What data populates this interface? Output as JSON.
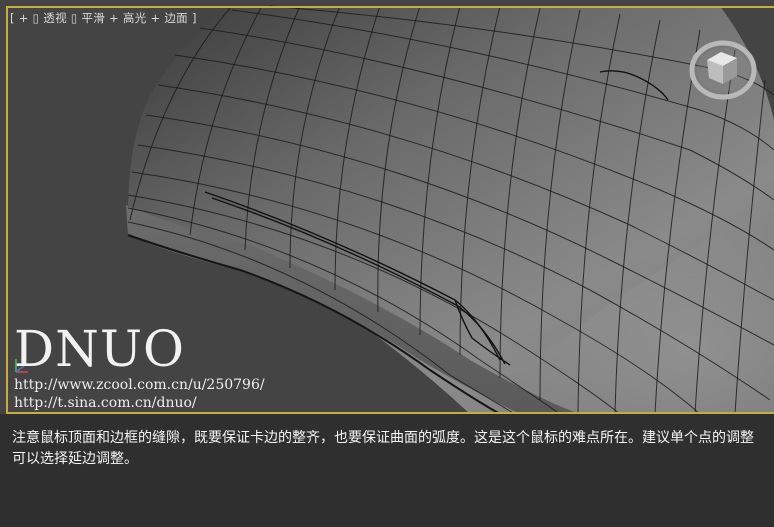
{
  "viewport": {
    "label": {
      "bracket_open": "[",
      "plus": "+",
      "view": "透视",
      "shading": "平滑 + 高光 + 边面",
      "bracket_close": "]",
      "glyph": "▯"
    },
    "border_color": "#c9ac3d",
    "background": "#444444",
    "icons": [
      "viewcube-icon",
      "axis-tripod-icon"
    ]
  },
  "watermark": {
    "title": "DNUO",
    "url1": "http://www.zcool.com.cn/u/250796/",
    "url2": "http://t.sina.com.cn/dnuo/"
  },
  "caption": {
    "text": "注意鼠标顶面和边框的缝隙，既要保证卡边的整齐，也要保证曲面的弧度。这是这个鼠标的难点所在。建议单个点的调整可以选择延边调整。"
  }
}
